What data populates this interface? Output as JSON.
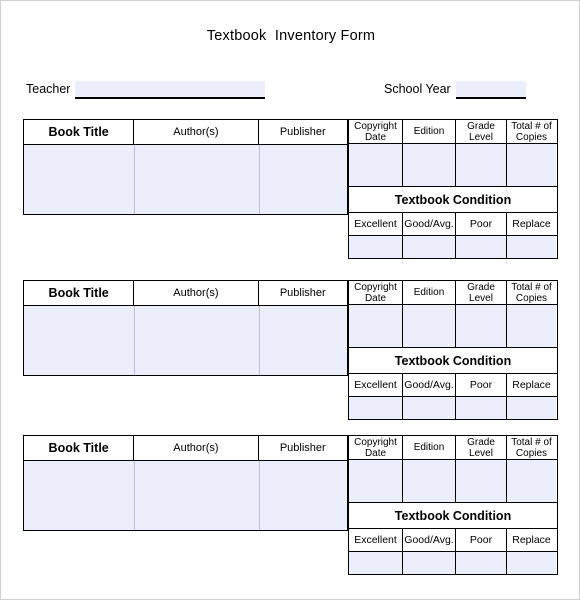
{
  "document": {
    "title": "Textbook  Inventory Form"
  },
  "meta": {
    "teacher_label": "Teacher",
    "teacher_value": "",
    "school_year_label": "School Year",
    "school_year_value": ""
  },
  "table": {
    "book_columns": [
      {
        "label": "Book Title",
        "value": ""
      },
      {
        "label": "Author(s)",
        "value": ""
      },
      {
        "label": "Publisher",
        "value": ""
      }
    ],
    "detail_columns": [
      {
        "label": "Copyright Date",
        "line1": "Copyright",
        "line2": "Date",
        "value": ""
      },
      {
        "label": "Edition",
        "line1": "Edition",
        "line2": "",
        "value": ""
      },
      {
        "label": "Grade Level",
        "line1": "Grade",
        "line2": "Level",
        "value": ""
      },
      {
        "label": "Total # of Copies",
        "line1": "Total # of",
        "line2": "Copies",
        "value": ""
      }
    ],
    "condition_title": "Textbook Condition",
    "condition_columns": [
      {
        "label": "Excellent",
        "value": ""
      },
      {
        "label": "Good/Avg.",
        "value": ""
      },
      {
        "label": "Poor",
        "value": ""
      },
      {
        "label": "Replace",
        "value": ""
      }
    ]
  },
  "blocks": [
    {
      "index": 1
    },
    {
      "index": 2
    },
    {
      "index": 3
    }
  ],
  "colors": {
    "field_fill": "#eceefc",
    "grid_line": "#000000",
    "page_border": "#cfcfcf",
    "text": "#000000"
  }
}
